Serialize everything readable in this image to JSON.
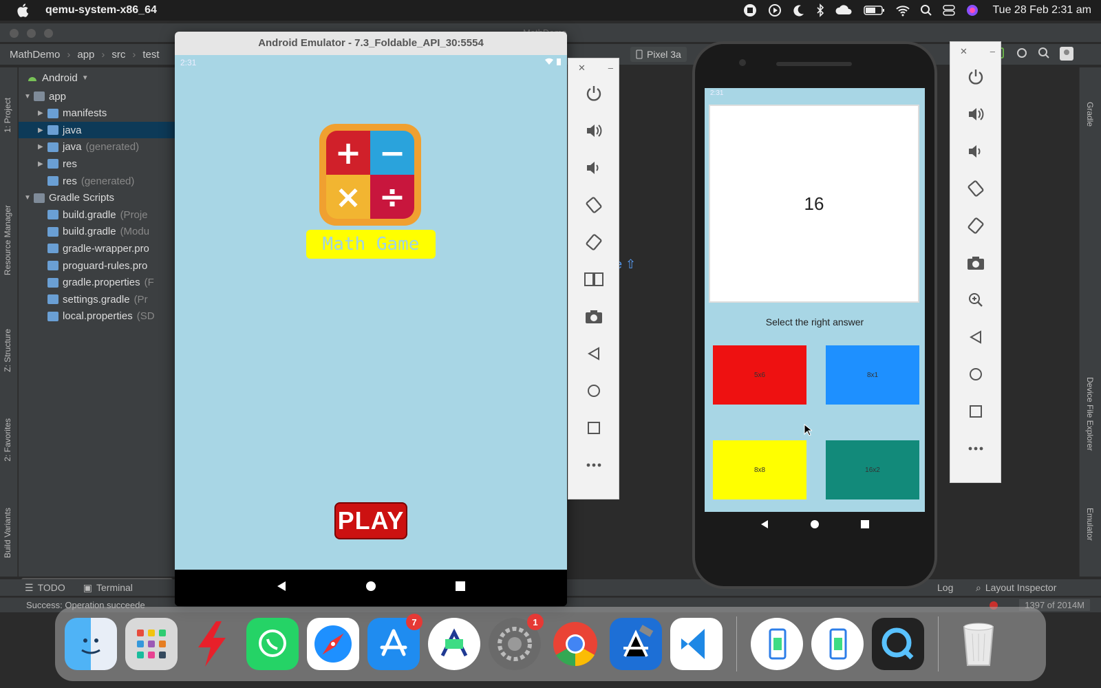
{
  "menubar": {
    "app_name": "qemu-system-x86_64",
    "clock": "Tue 28 Feb  2:31 am"
  },
  "ide": {
    "window_title": "MathDemo",
    "breadcrumb": [
      "MathDemo",
      "app",
      "src",
      "test"
    ],
    "device_selector": "Pixel 3a",
    "left_tool_labels": [
      "1: Project",
      "Resource Manager",
      "Z: Structure",
      "2: Favorites",
      "Build Variants"
    ],
    "right_tool_labels": [
      "Gradle",
      "Device File Explorer",
      "Emulator"
    ],
    "project_view": "Android",
    "tree": [
      {
        "label": "app",
        "detail": "",
        "level": 0,
        "expanded": true
      },
      {
        "label": "manifests",
        "detail": "",
        "level": 1,
        "expanded": false
      },
      {
        "label": "java",
        "detail": "",
        "level": 1,
        "expanded": false,
        "selected": true
      },
      {
        "label": "java",
        "detail": "(generated)",
        "level": 1,
        "expanded": false
      },
      {
        "label": "res",
        "detail": "",
        "level": 1,
        "expanded": false
      },
      {
        "label": "res",
        "detail": "(generated)",
        "level": 1,
        "expanded": null
      },
      {
        "label": "Gradle Scripts",
        "detail": "",
        "level": 0,
        "expanded": true
      },
      {
        "label": "build.gradle",
        "detail": "(Proje",
        "level": 1,
        "expanded": null
      },
      {
        "label": "build.gradle",
        "detail": "(Modu",
        "level": 1,
        "expanded": null
      },
      {
        "label": "gradle-wrapper.pro",
        "detail": "",
        "level": 1,
        "expanded": null
      },
      {
        "label": "proguard-rules.pro",
        "detail": "",
        "level": 1,
        "expanded": null
      },
      {
        "label": "gradle.properties",
        "detail": "(F",
        "level": 1,
        "expanded": null
      },
      {
        "label": "settings.gradle",
        "detail": "(Pr",
        "level": 1,
        "expanded": null
      },
      {
        "label": "local.properties",
        "detail": "(SD",
        "level": 1,
        "expanded": null
      }
    ],
    "editor_fragment": "ble",
    "bottom_tabs": [
      "TODO",
      "Terminal"
    ],
    "log_tab": "Log",
    "layout_inspector": "Layout Inspector",
    "status_message": "Success: Operation succeede",
    "memory": "1397 of 2014M"
  },
  "emulator1": {
    "title": "Android Emulator - 7.3_Foldable_API_30:5554",
    "time": "2:31",
    "game_title": "Math Game",
    "play_label": "PLAY",
    "logo_symbols": [
      "+",
      "−",
      "×",
      "÷"
    ]
  },
  "emulator2": {
    "time": "2:31",
    "question": "16",
    "prompt": "Select the right answer",
    "answers": [
      {
        "text": "5x6",
        "color": "#ee1111"
      },
      {
        "text": "8x1",
        "color": "#1e90ff"
      },
      {
        "text": "8x8",
        "color": "#ffff00"
      },
      {
        "text": "16x2",
        "color": "#128a7a"
      }
    ]
  },
  "dock": {
    "apps": [
      {
        "name": "Finder",
        "badge": ""
      },
      {
        "name": "Launchpad",
        "badge": ""
      },
      {
        "name": "Flash",
        "badge": ""
      },
      {
        "name": "WhatsApp",
        "badge": ""
      },
      {
        "name": "Safari",
        "badge": ""
      },
      {
        "name": "App Store",
        "badge": "7"
      },
      {
        "name": "Android Studio",
        "badge": ""
      },
      {
        "name": "System Preferences",
        "badge": "1"
      },
      {
        "name": "Chrome",
        "badge": ""
      },
      {
        "name": "Xcode",
        "badge": ""
      },
      {
        "name": "VS Code",
        "badge": ""
      },
      {
        "name": "Emulator 1",
        "badge": ""
      },
      {
        "name": "Emulator 2",
        "badge": ""
      },
      {
        "name": "QuickTime",
        "badge": ""
      },
      {
        "name": "Trash",
        "badge": ""
      }
    ]
  },
  "colors": {
    "emulator_bg": "#a8d6e5",
    "accent_blue": "#589df6",
    "ide_bg": "#2b2b2b"
  }
}
